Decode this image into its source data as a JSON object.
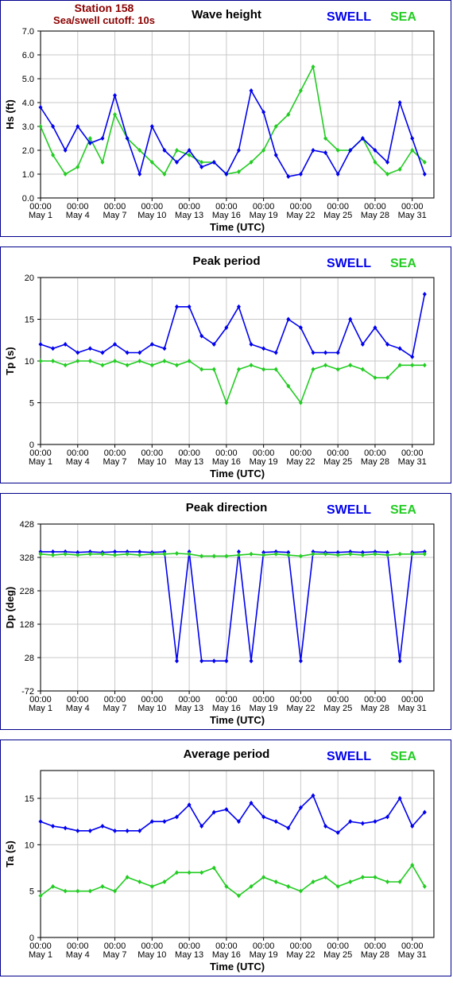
{
  "header": {
    "station": "Station 158",
    "cutoff": "Sea/swell cutoff: 10s"
  },
  "legend": {
    "swell": "SWELL",
    "sea": "SEA"
  },
  "colors": {
    "swell": "#0000ee",
    "sea": "#22cc22",
    "panel_border": "#00008b",
    "plot_bg": "#dcdcdc",
    "station": "#8b0000"
  },
  "x_ticks": [
    {
      "time": "00:00",
      "date": "May 1"
    },
    {
      "time": "00:00",
      "date": "May 4"
    },
    {
      "time": "00:00",
      "date": "May 7"
    },
    {
      "time": "00:00",
      "date": "May 10"
    },
    {
      "time": "00:00",
      "date": "May 13"
    },
    {
      "time": "00:00",
      "date": "May 16"
    },
    {
      "time": "00:00",
      "date": "May 19"
    },
    {
      "time": "00:00",
      "date": "May 22"
    },
    {
      "time": "00:00",
      "date": "May 25"
    },
    {
      "time": "00:00",
      "date": "May 28"
    },
    {
      "time": "00:00",
      "date": "May 31"
    }
  ],
  "chart_data": [
    {
      "type": "line",
      "title": "Wave height",
      "xlabel": "Time (UTC)",
      "ylabel": "Hs (ft)",
      "ylim": [
        0.0,
        7.0
      ],
      "y_ticks": [
        "0.0",
        "1.0",
        "2.0",
        "3.0",
        "4.0",
        "5.0",
        "6.0",
        "7.0"
      ],
      "x_day": [
        1,
        2,
        3,
        4,
        5,
        6,
        7,
        8,
        9,
        10,
        11,
        12,
        13,
        14,
        15,
        16,
        17,
        18,
        19,
        20,
        21,
        22,
        23,
        24,
        25,
        26,
        27,
        28,
        29,
        30,
        31,
        32
      ],
      "series": [
        {
          "name": "SWELL",
          "values": [
            3.8,
            3.0,
            2.0,
            3.0,
            2.3,
            2.5,
            4.3,
            2.5,
            1.0,
            3.0,
            2.0,
            1.5,
            2.0,
            1.3,
            1.5,
            1.0,
            2.0,
            4.5,
            3.6,
            1.8,
            0.9,
            1.0,
            2.0,
            1.9,
            1.0,
            2.0,
            2.5,
            2.0,
            1.5,
            4.0,
            2.5,
            1.0
          ]
        },
        {
          "name": "SEA",
          "values": [
            3.0,
            1.8,
            1.0,
            1.3,
            2.5,
            1.5,
            3.5,
            2.5,
            2.0,
            1.5,
            1.0,
            2.0,
            1.8,
            1.5,
            1.5,
            1.0,
            1.1,
            1.5,
            2.0,
            3.0,
            3.5,
            4.5,
            5.5,
            2.5,
            2.0,
            2.0,
            2.5,
            1.5,
            1.0,
            1.2,
            2.0,
            1.5
          ]
        }
      ]
    },
    {
      "type": "line",
      "title": "Peak period",
      "xlabel": "Time (UTC)",
      "ylabel": "Tp (s)",
      "ylim": [
        0,
        20
      ],
      "y_ticks": [
        "0",
        "5",
        "10",
        "15",
        "20"
      ],
      "x_day": [
        1,
        2,
        3,
        4,
        5,
        6,
        7,
        8,
        9,
        10,
        11,
        12,
        13,
        14,
        15,
        16,
        17,
        18,
        19,
        20,
        21,
        22,
        23,
        24,
        25,
        26,
        27,
        28,
        29,
        30,
        31,
        32
      ],
      "series": [
        {
          "name": "SWELL",
          "values": [
            12,
            11.5,
            12,
            11,
            11.5,
            11,
            12,
            11,
            11,
            12,
            11.5,
            16.5,
            16.5,
            13,
            12,
            14,
            16.5,
            12,
            11.5,
            11,
            15,
            14,
            11,
            11,
            11,
            15,
            12,
            14,
            12,
            11.5,
            10.5,
            18
          ]
        },
        {
          "name": "SEA",
          "values": [
            10,
            10,
            9.5,
            10,
            10,
            9.5,
            10,
            9.5,
            10,
            9.5,
            10,
            9.5,
            10,
            9,
            9,
            5,
            9,
            9.5,
            9,
            9,
            7,
            5,
            9,
            9.5,
            9,
            9.5,
            9,
            8,
            8,
            9.5,
            9.5,
            9.5
          ]
        }
      ]
    },
    {
      "type": "line",
      "title": "Peak direction",
      "xlabel": "Time (UTC)",
      "ylabel": "Dp (deg)",
      "ylim": [
        -72,
        428
      ],
      "y_ticks": [
        "-72",
        "28",
        "128",
        "228",
        "328",
        "428"
      ],
      "x_day": [
        1,
        2,
        3,
        4,
        5,
        6,
        7,
        8,
        9,
        10,
        11,
        12,
        13,
        14,
        15,
        16,
        17,
        18,
        19,
        20,
        21,
        22,
        23,
        24,
        25,
        26,
        27,
        28,
        29,
        30,
        31,
        32
      ],
      "series": [
        {
          "name": "SWELL",
          "values": [
            345,
            345,
            345,
            343,
            345,
            343,
            345,
            345,
            345,
            343,
            345,
            18,
            345,
            18,
            18,
            18,
            345,
            18,
            343,
            345,
            343,
            18,
            345,
            343,
            343,
            345,
            343,
            345,
            343,
            18,
            343,
            345
          ]
        },
        {
          "name": "SEA",
          "values": [
            338,
            335,
            338,
            335,
            338,
            338,
            335,
            338,
            335,
            338,
            338,
            340,
            338,
            332,
            332,
            332,
            335,
            338,
            335,
            338,
            335,
            332,
            338,
            338,
            335,
            338,
            335,
            338,
            335,
            338,
            338,
            338
          ]
        }
      ]
    },
    {
      "type": "line",
      "title": "Average period",
      "xlabel": "Time (UTC)",
      "ylabel": "Ta (s)",
      "ylim": [
        0,
        18
      ],
      "y_ticks": [
        "0",
        "5",
        "10",
        "15"
      ],
      "x_day": [
        1,
        2,
        3,
        4,
        5,
        6,
        7,
        8,
        9,
        10,
        11,
        12,
        13,
        14,
        15,
        16,
        17,
        18,
        19,
        20,
        21,
        22,
        23,
        24,
        25,
        26,
        27,
        28,
        29,
        30,
        31,
        32
      ],
      "series": [
        {
          "name": "SWELL",
          "values": [
            12.5,
            12,
            11.8,
            11.5,
            11.5,
            12,
            11.5,
            11.5,
            11.5,
            12.5,
            12.5,
            13,
            14.3,
            12,
            13.5,
            13.8,
            12.5,
            14.5,
            13,
            12.5,
            11.8,
            14,
            15.3,
            12,
            11.3,
            12.5,
            12.3,
            12.5,
            13,
            15,
            12,
            13.5
          ]
        },
        {
          "name": "SEA",
          "values": [
            4.5,
            5.5,
            5,
            5,
            5,
            5.5,
            5,
            6.5,
            6,
            5.5,
            6,
            7,
            7,
            7,
            7.5,
            5.5,
            4.5,
            5.5,
            6.5,
            6,
            5.5,
            5,
            6,
            6.5,
            5.5,
            6,
            6.5,
            6.5,
            6,
            6,
            7.8,
            5.5
          ]
        }
      ]
    }
  ]
}
